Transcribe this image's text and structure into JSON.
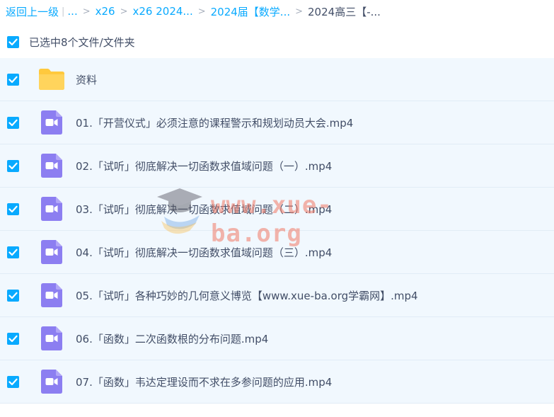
{
  "breadcrumb": {
    "back_label": "返回上一级",
    "separator": "|",
    "items": [
      "...",
      "x26",
      "x26 2024...",
      "2024届【数学...",
      "2024高三【-..."
    ]
  },
  "selection": {
    "summary": "已选中8个文件/文件夹"
  },
  "files": [
    {
      "name": "资料",
      "type": "folder",
      "icon": "folder-icon"
    },
    {
      "name": "01.「开营仪式」必须注意的课程警示和规划动员大会.mp4",
      "type": "video",
      "icon": "video-file-icon"
    },
    {
      "name": "02.「试听」彻底解决一切函数求值域问题（一）.mp4",
      "type": "video",
      "icon": "video-file-icon"
    },
    {
      "name": "03.「试听」彻底解决一切函数求值域问题（二）.mp4",
      "type": "video",
      "icon": "video-file-icon"
    },
    {
      "name": "04.「试听」彻底解决一切函数求值域问题（三）.mp4",
      "type": "video",
      "icon": "video-file-icon"
    },
    {
      "name": "05.「试听」各种巧妙的几何意义博览【www.xue-ba.org学霸网】.mp4",
      "type": "video",
      "icon": "video-file-icon"
    },
    {
      "name": "06.「函数」二次函数根的分布问题.mp4",
      "type": "video",
      "icon": "video-file-icon"
    },
    {
      "name": "07.「函数」韦达定理设而不求在多参问题的应用.mp4",
      "type": "video",
      "icon": "video-file-icon"
    }
  ],
  "watermark": {
    "text": "www.xue-ba.org"
  },
  "colors": {
    "accent": "#09aaff",
    "row_bg": "#f1f8fe",
    "folder": "#ffc93d",
    "video_icon": "#8c7ef1"
  }
}
